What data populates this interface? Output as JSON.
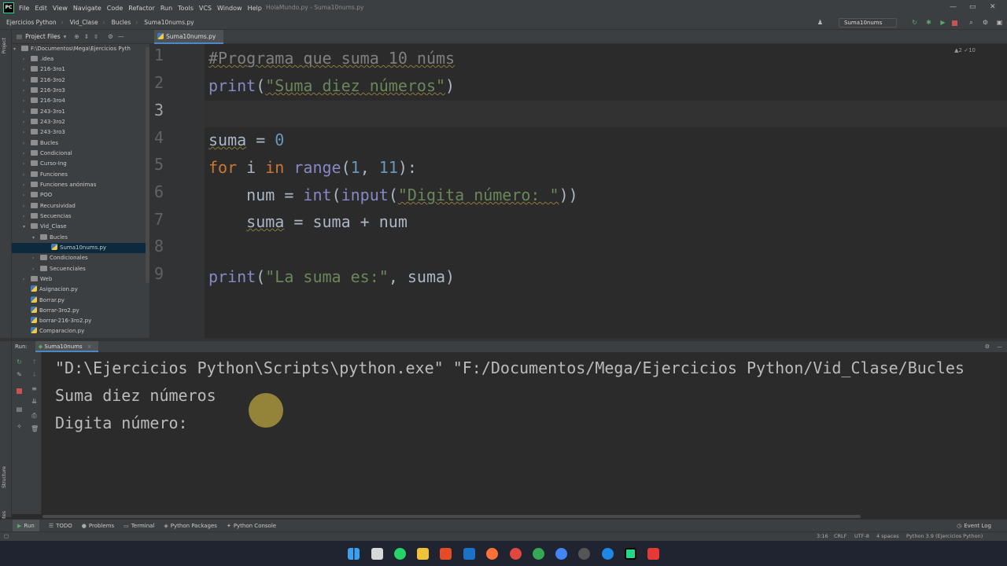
{
  "menubar": {
    "items": [
      "File",
      "Edit",
      "View",
      "Navigate",
      "Code",
      "Refactor",
      "Run",
      "Tools",
      "VCS",
      "Window",
      "Help"
    ],
    "window_title": "HolaMundo.py - Suma10nums.py"
  },
  "navbar": {
    "crumbs": [
      "Ejercicios Python",
      "Vid_Clase",
      "Bucles",
      "Suma10nums.py"
    ],
    "run_config": "Suma10nums"
  },
  "project": {
    "header": "Project Files",
    "root": "F:\\Documentos\\Mega\\Ejercicios Pyth",
    "items": [
      ".idea",
      "216-3ro1",
      "216-3ro2",
      "216-3ro3",
      "216-3ro4",
      "243-3ro1",
      "243-3ro2",
      "243-3ro3",
      "Bucles",
      "Condicional",
      "Curso-Ing",
      "Funciones",
      "Funciones anónimas",
      "POO",
      "Recursividad",
      "Secuencias",
      "Vid_Clase",
      "Bucles",
      "Suma10nums.py",
      "Condicionales",
      "Secuenciales",
      "Web",
      "Asignacion.py",
      "Borrar.py",
      "Borrar-3ro2.py",
      "borrar-216-3ro2.py",
      "Comparacion.py"
    ]
  },
  "editor": {
    "tab": "Suma10nums.py",
    "line_numbers": [
      "1",
      "2",
      "3",
      "4",
      "5",
      "6",
      "7",
      "8",
      "9"
    ],
    "inspection": "▲2  ✓10",
    "lines": {
      "l1": "#Programa que suma 10 núms",
      "l2_fn": "print",
      "l2_p1": "(",
      "l2_str": "\"Suma diez números\"",
      "l2_p2": ")",
      "l4_var": "suma",
      "l4_op": " = ",
      "l4_num": "0",
      "l5_kw1": "for",
      "l5_a": " i ",
      "l5_kw2": "in",
      "l5_b": " ",
      "l5_fn": "range",
      "l5_c": "(",
      "l5_n1": "1",
      "l5_d": ", ",
      "l5_n2": "11",
      "l5_e": "):",
      "l6_a": "    num = ",
      "l6_fn1": "int",
      "l6_b": "(",
      "l6_fn2": "input",
      "l6_c": "(",
      "l6_str": "\"Digita número: \"",
      "l6_d": "))",
      "l7_a": "    ",
      "l7_var": "suma",
      "l7_b": " = suma + num",
      "l9_fn": "print",
      "l9_a": "(",
      "l9_str": "\"La suma es:\"",
      "l9_b": ", suma)"
    }
  },
  "run": {
    "label": "Run:",
    "tab": "Suma10nums",
    "output": [
      "\"D:\\Ejercicios Python\\Scripts\\python.exe\" \"F:/Documentos/Mega/Ejercicios Python/Vid_Clase/Bucles",
      "Suma diez números",
      "Digita número: "
    ]
  },
  "bottom_tabs": [
    "Run",
    "TODO",
    "Problems",
    "Terminal",
    "Python Packages",
    "Python Console"
  ],
  "event_log": "Event Log",
  "status": {
    "position": "3:16",
    "line_sep": "CRLF",
    "encoding": "UTF-8",
    "indent": "4 spaces",
    "interpreter": "Python 3.9 (Ejercicios Python)"
  },
  "side_labels": {
    "project": "Project",
    "structure": "Structure",
    "favorites": "Favorites"
  },
  "colors": {
    "keyword": "#cc7832",
    "builtin": "#8888c6",
    "string": "#6a8759",
    "number": "#6897bb",
    "comment": "#808080",
    "accent": "#4a88c7"
  }
}
